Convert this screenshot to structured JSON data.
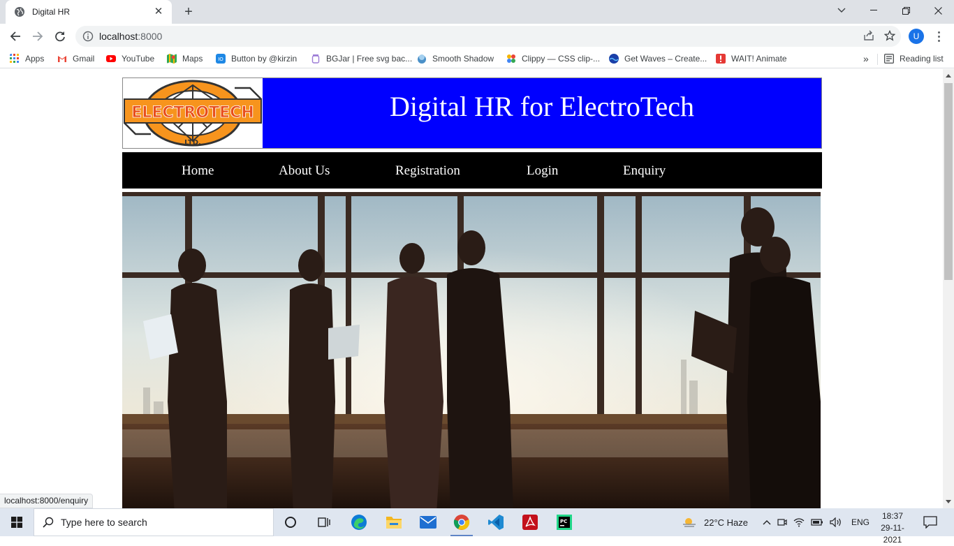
{
  "browser": {
    "tab_title": "Digital HR",
    "url_host": "localhost",
    "url_port": ":8000",
    "status_url": "localhost:8000/enquiry",
    "profile_initial": "U",
    "bookmarks": [
      {
        "label": "Apps",
        "icon": "apps-grid-icon",
        "color": "#4285f4"
      },
      {
        "label": "Gmail",
        "icon": "gmail-icon",
        "color": "#ea4335"
      },
      {
        "label": "YouTube",
        "icon": "youtube-icon",
        "color": "#ff0000"
      },
      {
        "label": "Maps",
        "icon": "maps-icon",
        "color": "#34a853"
      },
      {
        "label": "Button by @kirzin",
        "icon": "button-site-icon",
        "color": "#1e88e5"
      },
      {
        "label": "BGJar | Free svg bac...",
        "icon": "bgjar-icon",
        "color": "#9c7bd6"
      },
      {
        "label": "Smooth Shadow",
        "icon": "smooth-shadow-icon",
        "color": "#4a90c8"
      },
      {
        "label": "Clippy — CSS clip-...",
        "icon": "clippy-icon",
        "color": "#f4b400"
      },
      {
        "label": "Get Waves – Create...",
        "icon": "get-waves-icon",
        "color": "#1a3fa8"
      },
      {
        "label": "WAIT! Animate",
        "icon": "wait-animate-icon",
        "color": "#e53935"
      }
    ],
    "more_bookmarks": "»",
    "reading_list": "Reading list"
  },
  "page": {
    "logo_text": "ELECTROTECH",
    "logo_sub": "LTD.",
    "site_title": "Digital HR for ElectroTech",
    "nav": [
      {
        "label": "Home"
      },
      {
        "label": "About Us"
      },
      {
        "label": "Registration"
      },
      {
        "label": "Login"
      },
      {
        "label": "Enquiry"
      }
    ],
    "colors": {
      "header_bg": "#0000ff",
      "nav_bg": "#000000",
      "logo_orange": "#f7941d"
    }
  },
  "taskbar": {
    "search_placeholder": "Type here to search",
    "weather": "22°C  Haze",
    "language": "ENG",
    "time": "18:37",
    "date": "29-11-2021"
  }
}
